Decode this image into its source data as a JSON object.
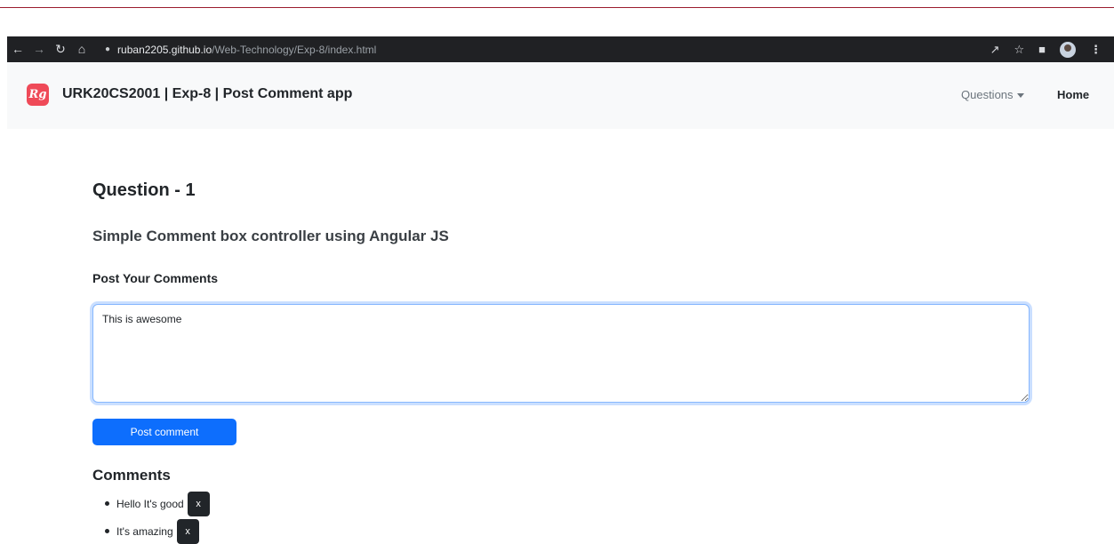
{
  "browser": {
    "url_host": "ruban2205.github.io",
    "url_path": "/Web-Technology/Exp-8/index.html"
  },
  "navbar": {
    "brand_logo": "Rg",
    "brand_title": "URK20CS2001 | Exp-8 | Post Comment app",
    "questions_label": "Questions",
    "home_label": "Home"
  },
  "main": {
    "question_title": "Question - 1",
    "question_subtitle": "Simple Comment box controller using Angular JS",
    "post_label": "Post Your Comments",
    "comment_value": "This is awesome",
    "post_button": "Post comment",
    "comments_title": "Comments",
    "comments": [
      {
        "text": "Hello It's good",
        "delete_label": "x"
      },
      {
        "text": "It's amazing",
        "delete_label": "x"
      }
    ]
  },
  "colors": {
    "accent": "#0d6efd",
    "brand": "#ef4a58",
    "browser_bar": "#202124"
  }
}
